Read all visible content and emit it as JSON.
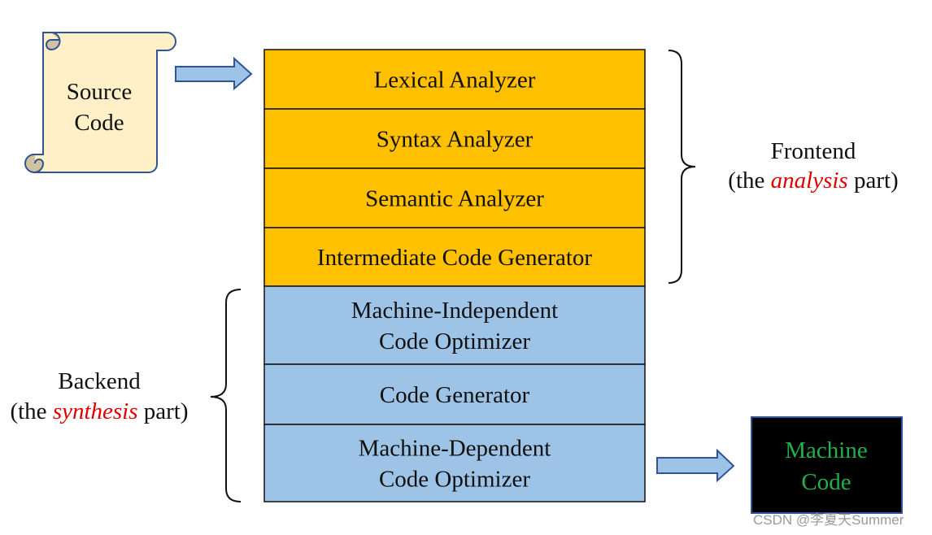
{
  "source": {
    "line1": "Source",
    "line2": "Code"
  },
  "stages": [
    {
      "lines": [
        "Lexical Analyzer"
      ]
    },
    {
      "lines": [
        "Syntax Analyzer"
      ]
    },
    {
      "lines": [
        "Semantic Analyzer"
      ]
    },
    {
      "lines": [
        "Intermediate Code Generator"
      ]
    },
    {
      "lines": [
        "Machine-Independent",
        "Code Optimizer"
      ]
    },
    {
      "lines": [
        "Code Generator"
      ]
    },
    {
      "lines": [
        "Machine-Dependent",
        "Code Optimizer"
      ]
    }
  ],
  "frontend": {
    "title": "Frontend",
    "pre": "(the ",
    "emph": "analysis",
    "post": " part)"
  },
  "backend": {
    "title": "Backend",
    "pre": "(the ",
    "emph": "synthesis",
    "post": " part)"
  },
  "target": {
    "line1": "Machine",
    "line2": "Code"
  },
  "watermark": "CSDN @李夏天Summer",
  "colors": {
    "frontend": "#FFC000",
    "backend": "#9DC3E6",
    "scroll": "#FFF0C8",
    "arrow": "#9DC3E6",
    "emph": "#E00000",
    "target_text": "#22B04A",
    "border": "#2F5597"
  }
}
